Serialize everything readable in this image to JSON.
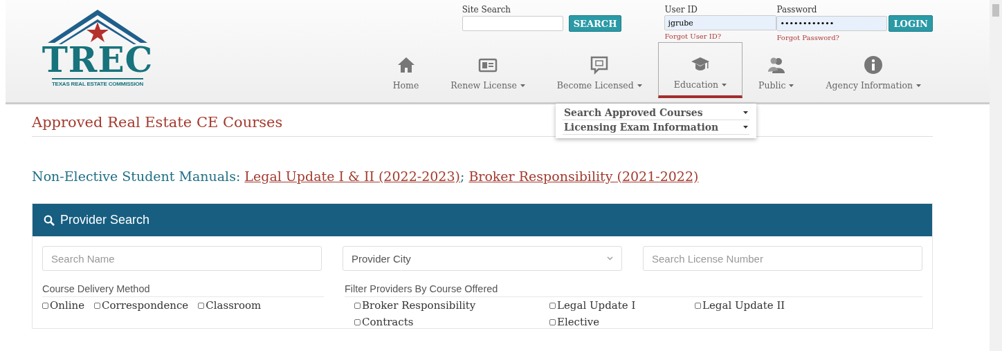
{
  "logo": {
    "wordmark": "TREC",
    "tagline": "TEXAS REAL ESTATE COMMISSION"
  },
  "site_search": {
    "label": "Site Search",
    "button": "SEARCH"
  },
  "login": {
    "user_label": "User ID",
    "user_value": "jgrube",
    "forgot_user": "Forgot User ID?",
    "password_label": "Password",
    "password_value": "••••••••••••",
    "forgot_password": "Forgot Password?",
    "button": "LOGIN"
  },
  "nav": [
    {
      "kind": "home",
      "label": "Home",
      "caret": false,
      "selected": false
    },
    {
      "kind": "card",
      "label": "Renew License",
      "caret": true,
      "selected": false
    },
    {
      "kind": "chat",
      "label": "Become Licensed",
      "caret": true,
      "selected": false
    },
    {
      "kind": "cap",
      "label": "Education",
      "caret": true,
      "selected": true
    },
    {
      "kind": "people",
      "label": "Public",
      "caret": true,
      "selected": false
    },
    {
      "kind": "info",
      "label": "Agency Information",
      "caret": true,
      "selected": false
    }
  ],
  "dropdown": [
    {
      "label": "Search Approved Courses"
    },
    {
      "label": "Licensing Exam Information"
    }
  ],
  "page_title": "Approved Real Estate CE Courses",
  "manuals": {
    "label": "Non-Elective Student Manuals:",
    "links": [
      "Legal Update I & II (2022-2023)",
      "Broker Responsibility (2021-2022)"
    ],
    "separator": ";"
  },
  "provider_search": {
    "title": "Provider Search",
    "fields": [
      {
        "kind": "text",
        "placeholder": "Search Name"
      },
      {
        "kind": "select",
        "placeholder": "Provider City"
      },
      {
        "kind": "text",
        "placeholder": "Search License Number"
      }
    ],
    "delivery": {
      "label": "Course Delivery Method",
      "options": [
        {
          "label": "Online",
          "checked": false
        },
        {
          "label": "Correspondence",
          "checked": false
        },
        {
          "label": "Classroom",
          "checked": false
        }
      ]
    },
    "courses": {
      "label": "Filter Providers By Course Offered",
      "options": [
        {
          "label": "Broker Responsibility",
          "checked": false
        },
        {
          "label": "Legal Update I",
          "checked": false
        },
        {
          "label": "Legal Update II",
          "checked": false
        },
        {
          "label": "Contracts",
          "checked": false
        },
        {
          "label": "Elective",
          "checked": false
        }
      ]
    }
  }
}
